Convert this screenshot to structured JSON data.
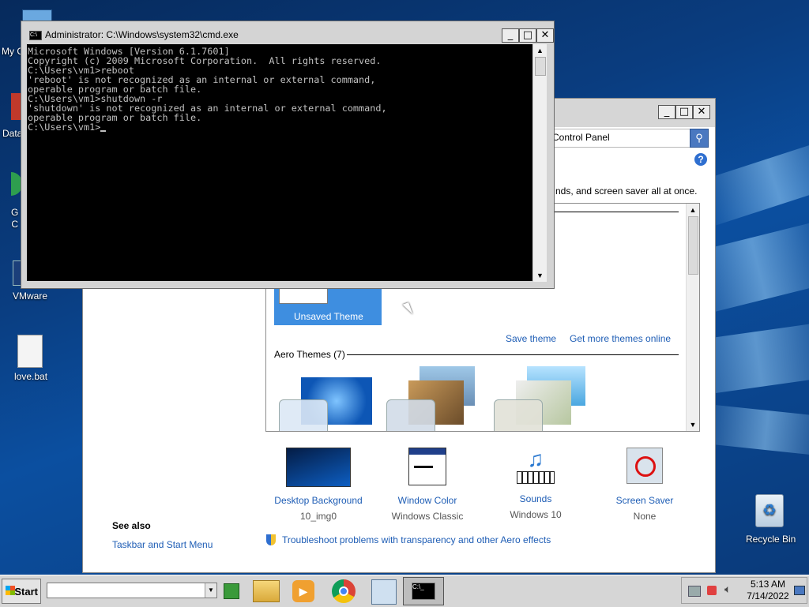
{
  "desktop": {
    "icons": [
      {
        "label": "My C"
      },
      {
        "label": "Data"
      },
      {
        "label": "G\nC"
      },
      {
        "label": "VMware"
      },
      {
        "label": "love.bat"
      },
      {
        "label": "Recycle Bin"
      }
    ]
  },
  "cmd": {
    "title": "Administrator: C:\\Windows\\system32\\cmd.exe",
    "lines": [
      "Microsoft Windows [Version 6.1.7601]",
      "Copyright (c) 2009 Microsoft Corporation.  All rights reserved.",
      "",
      "C:\\Users\\vm1>reboot",
      "'reboot' is not recognized as an internal or external command,",
      "operable program or batch file.",
      "",
      "C:\\Users\\vm1>shutdown -r",
      "'shutdown' is not recognized as an internal or external command,",
      "operable program or batch file.",
      "",
      "C:\\Users\\vm1>"
    ],
    "minimize": "_",
    "maximize": "□",
    "close": "✕"
  },
  "control_panel": {
    "address": "Control Panel",
    "description": "nds, and screen saver all at once.",
    "unsaved_theme": "Unsaved Theme",
    "save_theme": "Save theme",
    "get_more_themes": "Get more themes online",
    "aero_themes": "Aero Themes (7)",
    "settings": [
      {
        "title": "Desktop Background",
        "value": "10_img0"
      },
      {
        "title": "Window Color",
        "value": "Windows Classic"
      },
      {
        "title": "Sounds",
        "value": "Windows 10"
      },
      {
        "title": "Screen Saver",
        "value": "None"
      }
    ],
    "see_also": "See also",
    "taskbar_link": "Taskbar and Start Menu",
    "troubleshoot": "Troubleshoot problems with transparency and other Aero effects",
    "minimize": "_",
    "maximize": "□",
    "close": "✕"
  },
  "taskbar": {
    "start": "Start",
    "time": "5:13 AM",
    "date": "7/14/2022"
  },
  "colors": {
    "selected_theme": "#3e8ee0",
    "link": "#1e5db5",
    "console_bg": "#000000"
  }
}
